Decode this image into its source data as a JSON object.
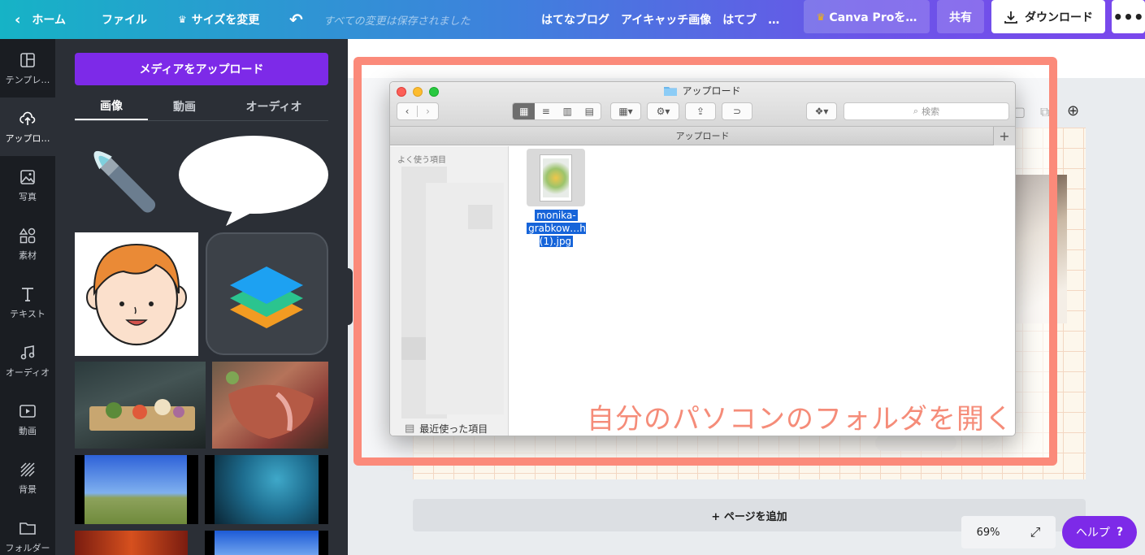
{
  "topbar": {
    "home": "ホーム",
    "file": "ファイル",
    "resize": "サイズを変更",
    "saved": "すべての変更は保存されました",
    "doc_title": "はてなブログ　アイキャッチ画像　はてブ　…",
    "pro": "Canva Proを…",
    "share": "共有",
    "download": "ダウンロード",
    "more": "•••"
  },
  "rail": {
    "items": [
      {
        "label": "テンプレ…",
        "icon": "template-icon"
      },
      {
        "label": "アップロ…",
        "icon": "upload-icon"
      },
      {
        "label": "写真",
        "icon": "photo-icon"
      },
      {
        "label": "素材",
        "icon": "elements-icon"
      },
      {
        "label": "テキスト",
        "icon": "text-icon"
      },
      {
        "label": "オーディオ",
        "icon": "music-icon"
      },
      {
        "label": "動画",
        "icon": "video-icon"
      },
      {
        "label": "背景",
        "icon": "background-icon"
      },
      {
        "label": "フォルダー",
        "icon": "folder-icon"
      }
    ]
  },
  "panel": {
    "upload_button": "メディアをアップロード",
    "tabs": [
      "画像",
      "動画",
      "オーディオ"
    ]
  },
  "canvas": {
    "add_page": "+ ページを追加",
    "zoom": "69%",
    "help": "ヘルプ",
    "help_icon": "?"
  },
  "finder": {
    "title": "アップロード",
    "path": "アップロード",
    "search_placeholder": "検索",
    "sidebar_header": "よく使う項目",
    "recent": "最近使った項目",
    "file_name_line1": "monika-",
    "file_name_line2": "grabkow…h (1).jpg"
  },
  "overlay": {
    "caption": "自分のパソコンのフォルダを開く"
  },
  "colors": {
    "accent": "#7d2ae8",
    "highlight": "#fb8a7a",
    "caption": "#f58c79"
  }
}
